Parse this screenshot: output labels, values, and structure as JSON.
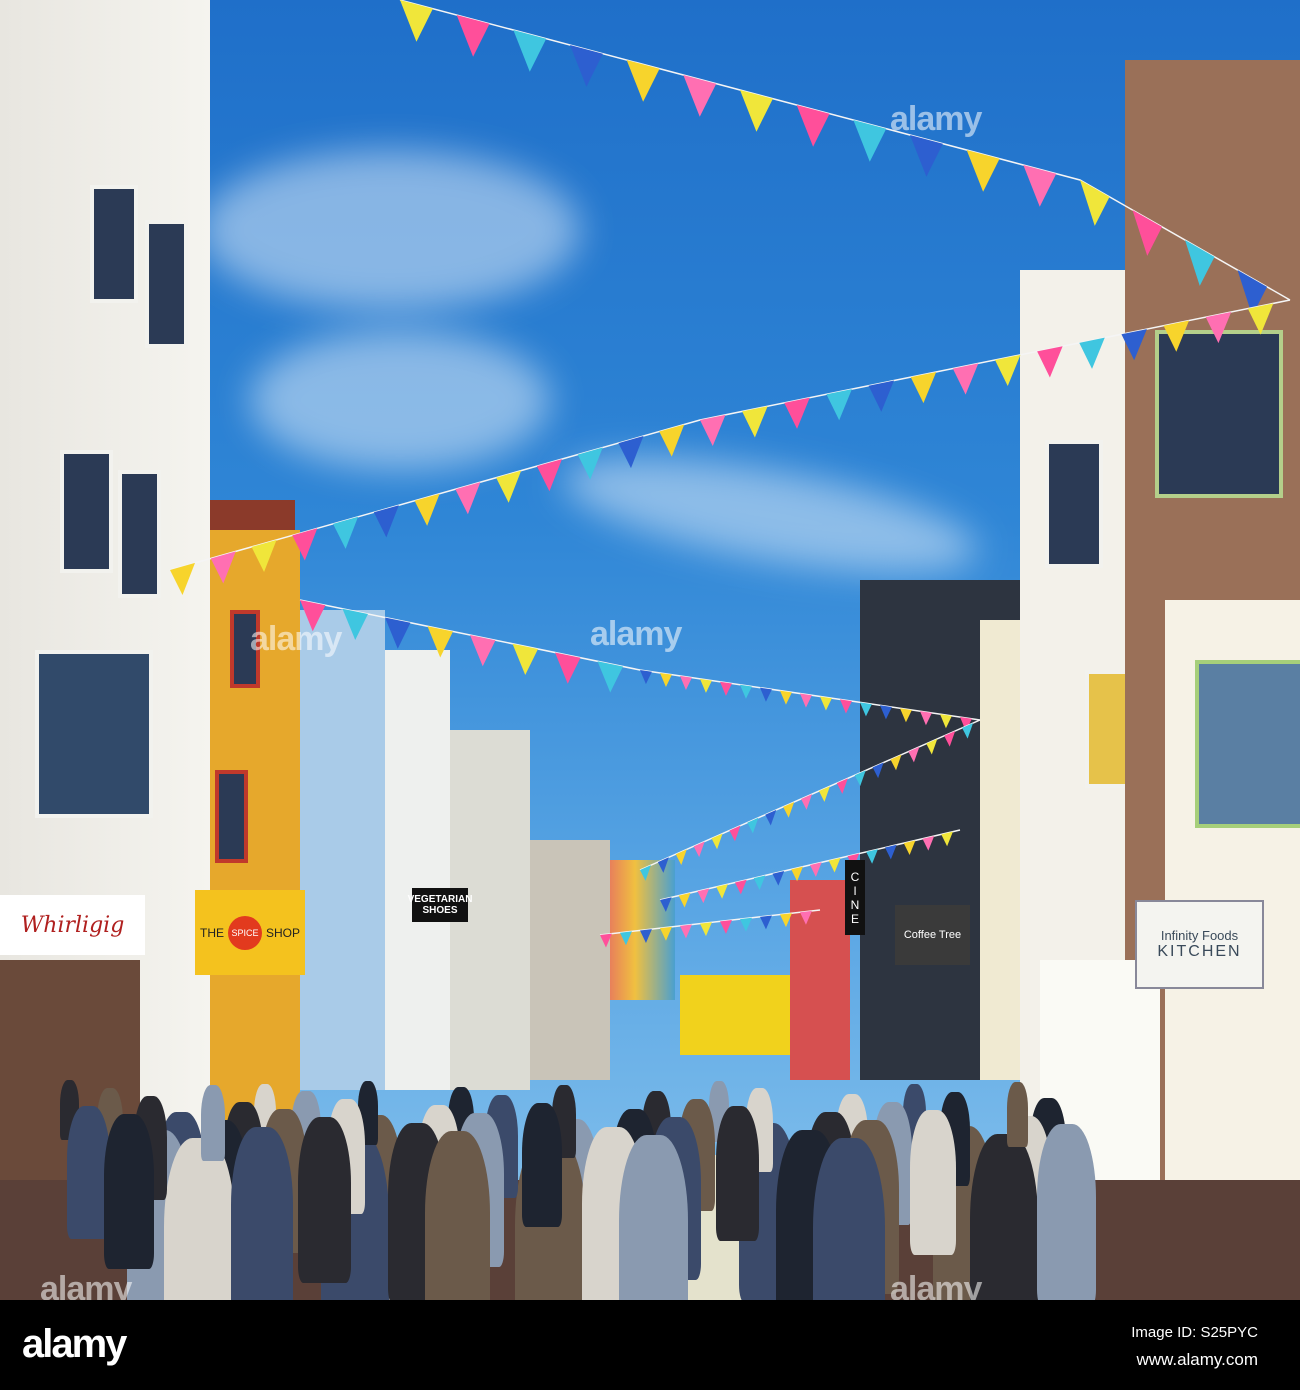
{
  "photo": {
    "watermark": "alamy",
    "bunting_colors": [
      "#f0e63a",
      "#ff4f9a",
      "#3fc6e0",
      "#2d5fd0",
      "#f7d42c",
      "#ff6fb2"
    ],
    "signs": {
      "whirligig": "Whirligig",
      "spice_shop_the": "THE",
      "spice_shop_spice": "SPICE",
      "spice_shop_shop": "SHOP",
      "vegetarian_shoes": "VEGETARIAN SHOES",
      "infinity_foods": "Infinity Foods",
      "kitchen": "KITCHEN",
      "coffee_tree": "Coffee Tree",
      "cinema": "CINE"
    }
  },
  "footer": {
    "logo": "alamy",
    "image_id": "Image ID: S25PYC",
    "website": "www.alamy.com"
  }
}
